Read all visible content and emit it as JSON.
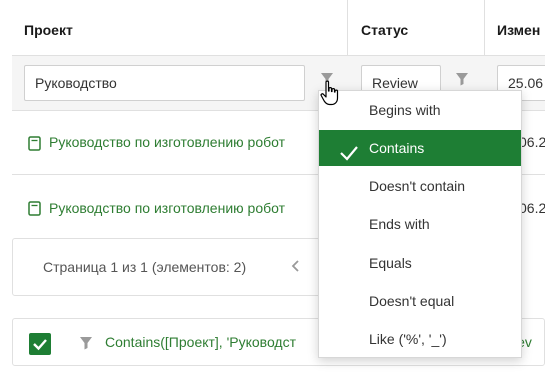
{
  "columns": {
    "project": "Проект",
    "status": "Статус",
    "modified": "Измен"
  },
  "filter_row": {
    "project_value": "Руководство",
    "status_value": "Review",
    "modified_value": "25.06"
  },
  "rows": [
    {
      "project": "Руководство по изготовлению робот",
      "modified": "06.2"
    },
    {
      "project": "Руководство по изготовлению робот",
      "modified": "06.2"
    }
  ],
  "pager": {
    "text": "Страница 1 из 1 (элементов: 2)",
    "prev_icon": "chevron-left-icon"
  },
  "footer": {
    "filter_expression": "Contains([Проект], 'Руководст",
    "right_text": "Rev"
  },
  "filter_menu": {
    "items": [
      {
        "label": "Begins with",
        "active": false
      },
      {
        "label": "Contains",
        "active": true
      },
      {
        "label": "Doesn't contain",
        "active": false
      },
      {
        "label": "Ends with",
        "active": false
      },
      {
        "label": "Equals",
        "active": false
      },
      {
        "label": "Doesn't equal",
        "active": false
      },
      {
        "label": "Like ('%', '_')",
        "active": false
      }
    ]
  },
  "colors": {
    "accent": "#1e7e34",
    "link": "#2e7d32",
    "border": "#e0e0e0"
  }
}
